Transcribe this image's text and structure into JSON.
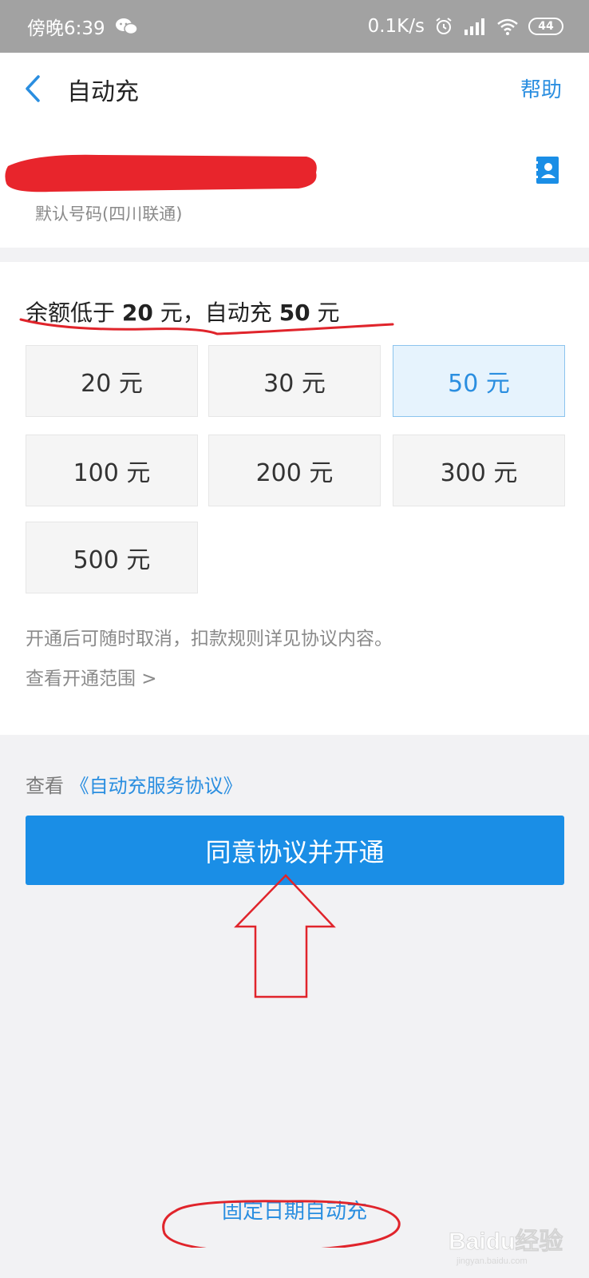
{
  "status_bar": {
    "time": "傍晚6:39",
    "network_speed": "0.1K/s",
    "battery": "44"
  },
  "nav": {
    "title": "自动充",
    "help": "帮助"
  },
  "phone": {
    "carrier_label": "默认号码(四川联通)"
  },
  "rule": {
    "prefix": "余额低于 ",
    "threshold": "20",
    "middle": " 元，自动充 ",
    "amount": "50",
    "suffix": " 元"
  },
  "amounts": [
    {
      "label": "20 元",
      "selected": false
    },
    {
      "label": "30 元",
      "selected": false
    },
    {
      "label": "50 元",
      "selected": true
    },
    {
      "label": "100 元",
      "selected": false
    },
    {
      "label": "200 元",
      "selected": false
    },
    {
      "label": "300 元",
      "selected": false
    },
    {
      "label": "500 元",
      "selected": false
    }
  ],
  "info": {
    "cancel_note": "开通后可随时取消，扣款规则详见协议内容。",
    "scope_link": "查看开通范围 >"
  },
  "agreement": {
    "prefix": "查看 ",
    "link": "《自动充服务协议》",
    "button": "同意协议并开通"
  },
  "bottom": {
    "fixed_date_link": "固定日期自动充"
  },
  "watermark": {
    "text": "Baidu经验",
    "sub": "jingyan.baidu.com"
  },
  "colors": {
    "accent": "#1a8ee6",
    "link": "#2a8ee0",
    "annotation": "#e0242b"
  }
}
